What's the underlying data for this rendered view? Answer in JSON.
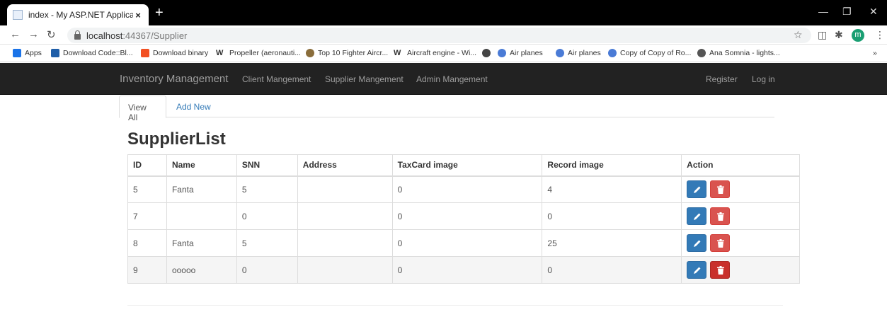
{
  "browser": {
    "tab_title": "index - My ASP.NET Application",
    "tab_close": "×",
    "new_tab": "+",
    "url_host": "localhost",
    "url_path": ":44367/Supplier",
    "avatar_letter": "m",
    "window_controls": [
      "—",
      "❐",
      "✕"
    ],
    "bookmarks": [
      {
        "label": "Apps",
        "icon": "apps-grid-icon",
        "color": "#1a73e8"
      },
      {
        "label": "Download Code::Bl...",
        "icon": "sf-icon",
        "color": "#1f5ea8"
      },
      {
        "label": "Download binary",
        "icon": "windows-icon",
        "color": "#f25022"
      },
      {
        "label": "Propeller (aeronauti...",
        "icon": "wikipedia-icon",
        "color": "#333333"
      },
      {
        "label": "Top 10 Fighter Aircr...",
        "icon": "site-icon",
        "color": "#8a6d3b"
      },
      {
        "label": "Aircraft engine - Wi...",
        "icon": "wikipedia-icon",
        "color": "#333333"
      },
      {
        "label": "",
        "icon": "globe-icon",
        "color": "#444444"
      },
      {
        "label": "Air planes",
        "icon": "globe-icon",
        "color": "#4a7bd6"
      },
      {
        "label": "Air planes",
        "icon": "globe-icon",
        "color": "#4a7bd6"
      },
      {
        "label": "Copy of Copy of Ro...",
        "icon": "globe-icon",
        "color": "#4a7bd6"
      },
      {
        "label": "Ana Somnia - lights...",
        "icon": "site-icon",
        "color": "#555555"
      }
    ],
    "more": "»"
  },
  "navbar": {
    "brand": "Inventory Management",
    "links": [
      "Client Mangement",
      "Supplier Mangement",
      "Admin Mangement"
    ],
    "register": "Register",
    "login": "Log in"
  },
  "subtabs": {
    "active": "View All",
    "other": "Add New"
  },
  "page": {
    "title": "SupplierList"
  },
  "table": {
    "headers": [
      "ID",
      "Name",
      "SNN",
      "Address",
      "TaxCard image",
      "Record image",
      "Action"
    ],
    "rows": [
      {
        "id": "5",
        "name": "Fanta",
        "snn": "5",
        "address": "",
        "taxcard": "0",
        "record": "4"
      },
      {
        "id": "7",
        "name": "",
        "snn": "0",
        "address": "",
        "taxcard": "0",
        "record": "0"
      },
      {
        "id": "8",
        "name": "Fanta",
        "snn": "5",
        "address": "",
        "taxcard": "0",
        "record": "25"
      },
      {
        "id": "9",
        "name": "ooooo",
        "snn": "0",
        "address": "",
        "taxcard": "0",
        "record": "0"
      }
    ]
  },
  "colors": {
    "primary": "#337ab7",
    "danger": "#d9534f",
    "navbar": "#222222"
  }
}
